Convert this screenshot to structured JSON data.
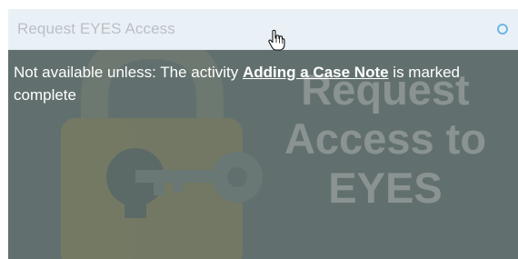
{
  "activity": {
    "title": "Request EYES Access",
    "status_color": "#6fb6e6"
  },
  "restriction": {
    "prefix": "Not available unless: The activity ",
    "link_text": "Adding a Case Note",
    "suffix": " is marked complete"
  },
  "image_text": {
    "line1": "Request",
    "line2": "Access to",
    "line3": "EYES"
  },
  "icons": {
    "status": "circle-outline-icon",
    "cursor": "hand-pointer-icon",
    "art": "padlock-key-icon"
  }
}
